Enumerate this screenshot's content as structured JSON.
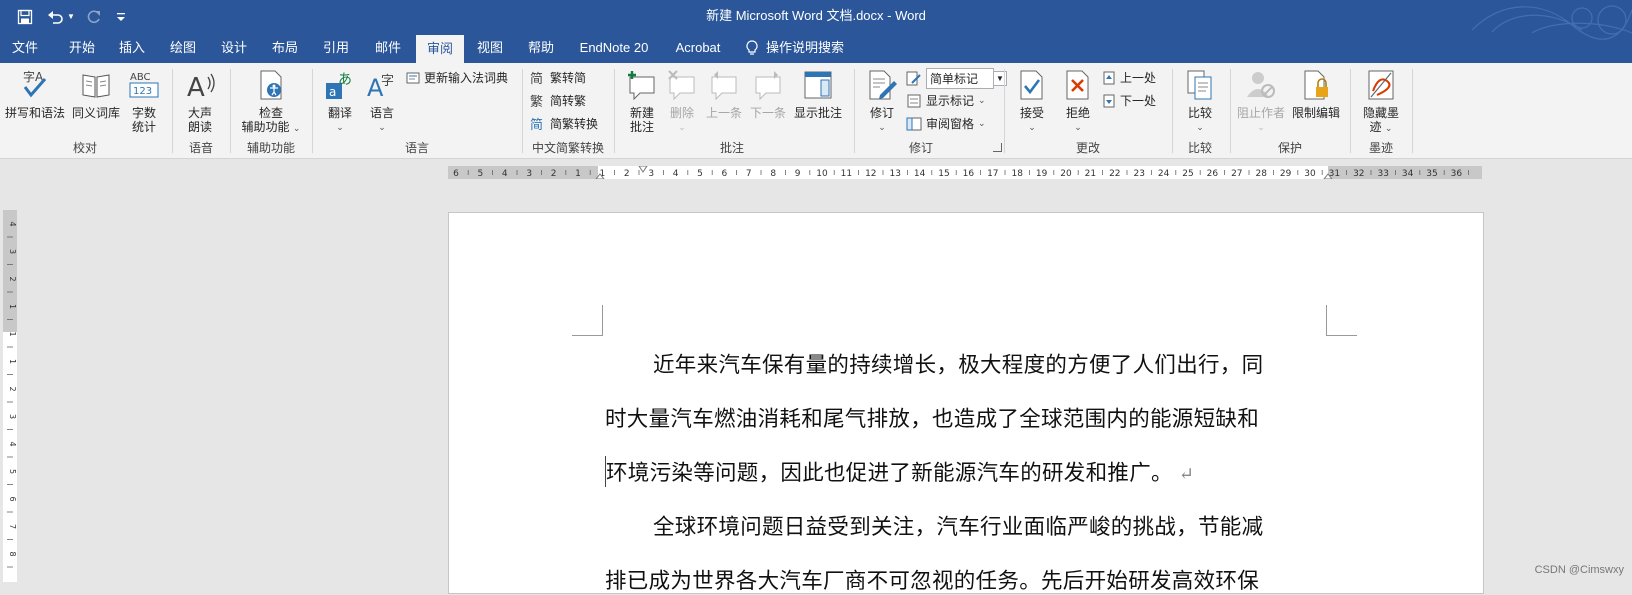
{
  "window": {
    "title": "新建 Microsoft Word 文档.docx  -  Word",
    "icons": [
      "save-icon",
      "undo-icon",
      "redo-icon",
      "customize-qat-icon"
    ]
  },
  "tabs": [
    "文件",
    "开始",
    "插入",
    "绘图",
    "设计",
    "布局",
    "引用",
    "邮件",
    "审阅",
    "视图",
    "帮助",
    "EndNote 20",
    "Acrobat"
  ],
  "active_tab": "审阅",
  "tell_me": "操作说明搜索",
  "ribbon": {
    "proofing": {
      "spelling": "拼写和语法",
      "thesaurus": "同义词库",
      "wordcount_1": "字数",
      "wordcount_2": "统计",
      "label": "校对"
    },
    "speech": {
      "read_1": "大声",
      "read_2": "朗读",
      "label": "语音"
    },
    "accessibility": {
      "check_1": "检查",
      "check_2": "辅助功能",
      "label": "辅助功能"
    },
    "language": {
      "translate": "翻译",
      "language": "语言",
      "update_ime": "更新输入法词典",
      "label": "语言"
    },
    "chinese": {
      "to_simplified": "繁转简",
      "to_traditional": "简转繁",
      "convert": "简繁转换",
      "label": "中文简繁转换"
    },
    "comments": {
      "new_1": "新建",
      "new_2": "批注",
      "delete": "删除",
      "previous": "上一条",
      "next": "下一条",
      "show": "显示批注",
      "label": "批注"
    },
    "tracking": {
      "track": "修订",
      "markup_select": "简单标记",
      "show_markup": "显示标记",
      "reviewing_pane": "审阅窗格",
      "label": "修订"
    },
    "changes": {
      "accept": "接受",
      "reject": "拒绝",
      "previous": "上一处",
      "next": "下一处",
      "label": "更改"
    },
    "compare": {
      "compare": "比较",
      "label": "比较"
    },
    "protect": {
      "block_authors": "阻止作者",
      "restrict": "限制编辑",
      "label": "保护"
    },
    "ink": {
      "hide_1": "隐藏墨",
      "hide_2": "迹",
      "label": "墨迹"
    }
  },
  "hruler_numbers": [
    "6",
    "5",
    "4",
    "3",
    "2",
    "1",
    "1",
    "2",
    "3",
    "4",
    "5",
    "6",
    "7",
    "8",
    "9",
    "10",
    "11",
    "12",
    "13",
    "14",
    "15",
    "16",
    "17",
    "18",
    "19",
    "20",
    "21",
    "22",
    "23",
    "24",
    "25",
    "26",
    "27",
    "28",
    "29",
    "30",
    "31",
    "32",
    "33",
    "34",
    "35",
    "36"
  ],
  "vruler_numbers": [
    "4",
    "3",
    "2",
    "1",
    "1",
    "1",
    "2",
    "3",
    "4",
    "5",
    "6",
    "7",
    "8"
  ],
  "document": {
    "line1": "近年来汽车保有量的持续增长，极大程度的方便了人们出行，同",
    "line2": "时大量汽车燃油消耗和尾气排放，也造成了全球范围内的能源短缺和",
    "line3": "环境污染等问题，因此也促进了新能源汽车的研发和推广。",
    "paragraph_mark": "↵",
    "line4": "全球环境问题日益受到关注，汽车行业面临严峻的挑战，节能减",
    "line5": "排已成为世界各大汽车厂商不可忽视的任务。先后开始研发高效环保"
  },
  "watermark": "CSDN @Cimswxy",
  "colors": {
    "brand": "#2b579a",
    "ribbon": "#f3f3f3",
    "workspace": "#e6e6e6",
    "accent_blue": "#2e75b6",
    "reject_red": "#d83b01"
  }
}
